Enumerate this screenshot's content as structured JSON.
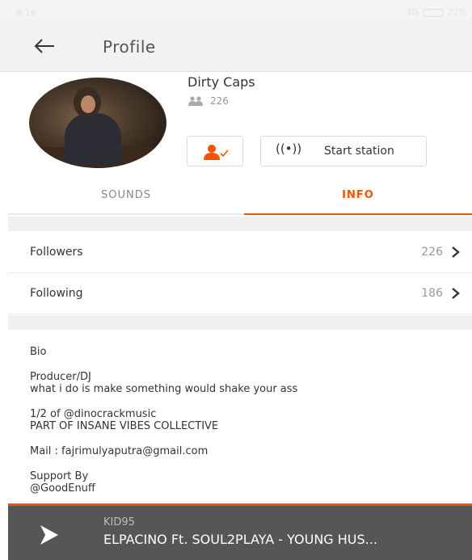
{
  "status_bar": {
    "time": "8:16",
    "network": "4G",
    "battery": "77%"
  },
  "appbar": {
    "title": "Profile"
  },
  "profile": {
    "name": "Dirty Caps",
    "followers_count": "226"
  },
  "actions": {
    "station_icon": "((•))",
    "start_station_label": "Start station"
  },
  "tabs": [
    {
      "label": "SOUNDS",
      "active": false
    },
    {
      "label": "INFO",
      "active": true
    }
  ],
  "stats": [
    {
      "label": "Followers",
      "value": "226"
    },
    {
      "label": "Following",
      "value": "186"
    }
  ],
  "bio": {
    "heading": "Bio",
    "lines": [
      "Producer/DJ",
      "what i do is make something would shake your ass",
      "1/2 of @dinocrackmusic",
      "PART OF INSANE VIBES COLLECTIVE",
      "Mail : fajrimulyaputra@gmail.com",
      "Support By",
      "@GoodEnuff"
    ]
  },
  "player": {
    "artist": "KID95",
    "track": "ELPACINO Ft. SOUL2PLAYA - YOUNG HUS..."
  },
  "colors": {
    "accent": "#f35400",
    "player_bg": "#565656",
    "divider": "#f0f0f0"
  },
  "icons": {
    "back": "back-arrow-icon",
    "followers": "people-icon",
    "follow": "follow-user-icon",
    "station": "radio-station-icon",
    "chevron": "chevron-right-icon",
    "play": "play-icon"
  }
}
